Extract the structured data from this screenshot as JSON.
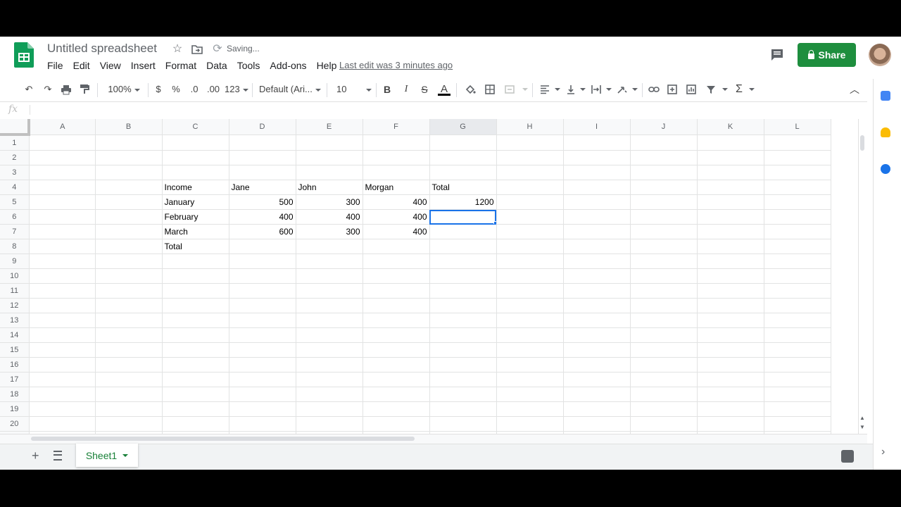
{
  "app": {
    "title": "Untitled spreadsheet",
    "status": "Saving...",
    "last_edit": "Last edit was 3 minutes ago",
    "share_label": "Share",
    "brand_color": "#1e8e3e",
    "accent_color": "#1a73e8"
  },
  "menu": [
    "File",
    "Edit",
    "View",
    "Insert",
    "Format",
    "Data",
    "Tools",
    "Add-ons",
    "Help"
  ],
  "toolbar": {
    "zoom": "100%",
    "currency": "$",
    "percent": "%",
    "dec_decrease": ".0",
    "dec_increase": ".00",
    "more_formats": "123",
    "font": "Default (Ari...",
    "font_size": "10",
    "bold": "B",
    "italic": "I",
    "strike": "S",
    "text_color": "A",
    "function": "Σ"
  },
  "formula_bar": {
    "fx": "fx",
    "value": ""
  },
  "grid": {
    "columns": [
      "A",
      "B",
      "C",
      "D",
      "E",
      "F",
      "G",
      "H",
      "I",
      "J",
      "K",
      "L"
    ],
    "selected_column": "G",
    "selected_row": 6,
    "rows": [
      [
        "",
        "",
        "",
        "",
        "",
        "",
        "",
        "",
        "",
        "",
        "",
        ""
      ],
      [
        "",
        "",
        "",
        "",
        "",
        "",
        "",
        "",
        "",
        "",
        "",
        ""
      ],
      [
        "",
        "",
        "",
        "",
        "",
        "",
        "",
        "",
        "",
        "",
        "",
        ""
      ],
      [
        "",
        "",
        "Income",
        "Jane",
        "John",
        "Morgan",
        "Total",
        "",
        "",
        "",
        "",
        ""
      ],
      [
        "",
        "",
        "January",
        "500",
        "300",
        "400",
        "1200",
        "",
        "",
        "",
        "",
        ""
      ],
      [
        "",
        "",
        "February",
        "400",
        "400",
        "400",
        "",
        "",
        "",
        "",
        "",
        ""
      ],
      [
        "",
        "",
        "March",
        "600",
        "300",
        "400",
        "",
        "",
        "",
        "",
        "",
        ""
      ],
      [
        "",
        "",
        "Total",
        "",
        "",
        "",
        "",
        "",
        "",
        "",
        "",
        ""
      ],
      [
        "",
        "",
        "",
        "",
        "",
        "",
        "",
        "",
        "",
        "",
        "",
        ""
      ],
      [
        "",
        "",
        "",
        "",
        "",
        "",
        "",
        "",
        "",
        "",
        "",
        ""
      ],
      [
        "",
        "",
        "",
        "",
        "",
        "",
        "",
        "",
        "",
        "",
        "",
        ""
      ],
      [
        "",
        "",
        "",
        "",
        "",
        "",
        "",
        "",
        "",
        "",
        "",
        ""
      ],
      [
        "",
        "",
        "",
        "",
        "",
        "",
        "",
        "",
        "",
        "",
        "",
        ""
      ],
      [
        "",
        "",
        "",
        "",
        "",
        "",
        "",
        "",
        "",
        "",
        "",
        ""
      ],
      [
        "",
        "",
        "",
        "",
        "",
        "",
        "",
        "",
        "",
        "",
        "",
        ""
      ],
      [
        "",
        "",
        "",
        "",
        "",
        "",
        "",
        "",
        "",
        "",
        "",
        ""
      ],
      [
        "",
        "",
        "",
        "",
        "",
        "",
        "",
        "",
        "",
        "",
        "",
        ""
      ],
      [
        "",
        "",
        "",
        "",
        "",
        "",
        "",
        "",
        "",
        "",
        "",
        ""
      ],
      [
        "",
        "",
        "",
        "",
        "",
        "",
        "",
        "",
        "",
        "",
        "",
        ""
      ],
      [
        "",
        "",
        "",
        "",
        "",
        "",
        "",
        "",
        "",
        "",
        "",
        ""
      ],
      [
        "",
        "",
        "",
        "",
        "",
        "",
        "",
        "",
        "",
        "",
        "",
        ""
      ],
      [
        "",
        "",
        "",
        "",
        "",
        "",
        "",
        "",
        "",
        "",
        "",
        ""
      ]
    ]
  },
  "sheets": [
    {
      "name": "Sheet1",
      "active": true
    }
  ],
  "icons": {
    "star": "star-icon",
    "move": "move-to-folder-icon",
    "sync": "sync-icon",
    "comment": "comment-icon",
    "undo": "undo-icon",
    "redo": "redo-icon",
    "print": "print-icon",
    "paint": "paint-format-icon"
  }
}
